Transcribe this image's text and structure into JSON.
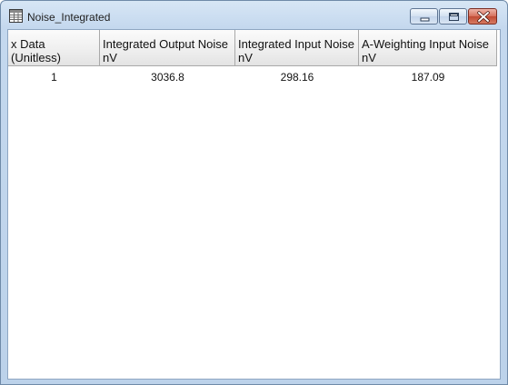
{
  "window": {
    "title": "Noise_Integrated"
  },
  "table": {
    "columns": [
      {
        "line1": "x Data",
        "line2": "(Unitless)"
      },
      {
        "line1": "Integrated Output Noise",
        "line2": "nV"
      },
      {
        "line1": "Integrated Input Noise",
        "line2": "nV"
      },
      {
        "line1": "A-Weighting Input Noise",
        "line2": "nV"
      }
    ],
    "rows": [
      [
        "1",
        "3036.8",
        "298.16",
        "187.09"
      ]
    ]
  }
}
